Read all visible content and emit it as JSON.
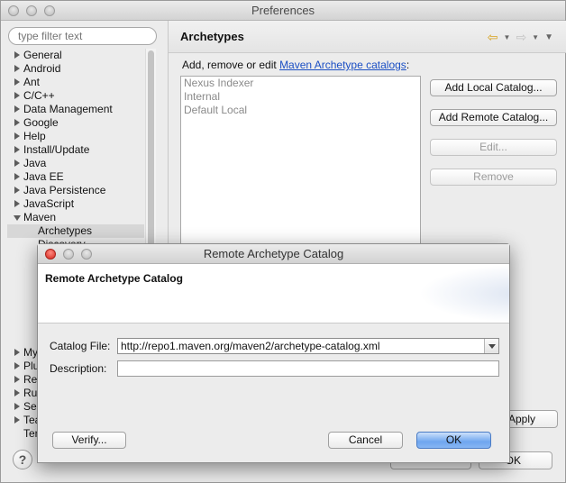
{
  "window": {
    "title": "Preferences"
  },
  "filter": {
    "placeholder": "type filter text"
  },
  "tree": {
    "items": [
      {
        "label": "General",
        "expanded": false
      },
      {
        "label": "Android",
        "expanded": false
      },
      {
        "label": "Ant",
        "expanded": false
      },
      {
        "label": "C/C++",
        "expanded": false
      },
      {
        "label": "Data Management",
        "expanded": false
      },
      {
        "label": "Google",
        "expanded": false
      },
      {
        "label": "Help",
        "expanded": false
      },
      {
        "label": "Install/Update",
        "expanded": false
      },
      {
        "label": "Java",
        "expanded": false
      },
      {
        "label": "Java EE",
        "expanded": false
      },
      {
        "label": "Java Persistence",
        "expanded": false
      },
      {
        "label": "JavaScript",
        "expanded": false
      },
      {
        "label": "Maven",
        "expanded": true
      }
    ],
    "maven_children": [
      {
        "label": "Archetypes",
        "selected": true
      },
      {
        "label": "Discovery",
        "selected": false
      }
    ],
    "partial_items": [
      "My",
      "Plu",
      "Rem",
      "Run",
      "Ser",
      "Tea",
      "Ter"
    ]
  },
  "page": {
    "title": "Archetypes",
    "intro_prefix": "Add, remove or edit ",
    "intro_link": "Maven Archetype catalogs",
    "intro_suffix": ":",
    "catalogs": [
      "Nexus Indexer",
      "Internal",
      "Default Local"
    ],
    "buttons": {
      "add_local": "Add Local Catalog...",
      "add_remote": "Add Remote Catalog...",
      "edit": "Edit...",
      "remove": "Remove"
    },
    "apply_label": "Apply"
  },
  "footer": {
    "help_label": "?",
    "ok_label": "OK"
  },
  "dialog": {
    "title": "Remote Archetype Catalog",
    "header_title": "Remote Archetype Catalog",
    "catalog_file_label": "Catalog File:",
    "catalog_file_value": "http://repo1.maven.org/maven2/archetype-catalog.xml",
    "description_label": "Description:",
    "description_value": "",
    "verify_label": "Verify...",
    "cancel_label": "Cancel",
    "ok_label": "OK"
  },
  "colors": {
    "link": "#1b4fc4",
    "default_button": "#6fa6ef",
    "close_light": "#d5261d",
    "back_arrow": "#d8a21d"
  },
  "icons": [
    "back-arrow-icon",
    "forward-arrow-icon",
    "view-menu-icon",
    "help-icon",
    "combo-arrow-icon"
  ]
}
